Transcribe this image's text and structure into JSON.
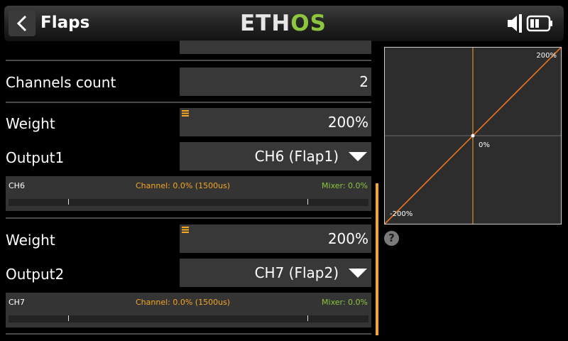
{
  "header": {
    "title": "Flaps",
    "logo_main": "ETH",
    "logo_accent": "OS"
  },
  "settings": {
    "channels_count_label": "Channels count",
    "channels_count_value": "2"
  },
  "outputs": [
    {
      "weight_label": "Weight",
      "weight_value": "200%",
      "output_label": "Output1",
      "output_value": "CH6 (Flap1)",
      "monitor": {
        "channel": "CH6",
        "channel_text": "Channel: 0.0% (1500us)",
        "mixer_text": "Mixer: 0.0%"
      }
    },
    {
      "weight_label": "Weight",
      "weight_value": "200%",
      "output_label": "Output2",
      "output_value": "CH7 (Flap2)",
      "monitor": {
        "channel": "CH7",
        "channel_text": "Channel: 0.0% (1500us)",
        "mixer_text": "Mixer: 0.0%"
      }
    }
  ],
  "curve": {
    "max_label": "200%",
    "mid_label": "0%",
    "min_label": "-200%"
  },
  "colors": {
    "accent_orange": "#f5a623",
    "accent_green": "#8cc63f",
    "field_bg": "#383838"
  },
  "icons": {
    "back": "chevron-left-icon",
    "speaker": "speaker-icon",
    "battery": "battery-icon",
    "help": "help-icon",
    "trim": "trim-icon"
  }
}
